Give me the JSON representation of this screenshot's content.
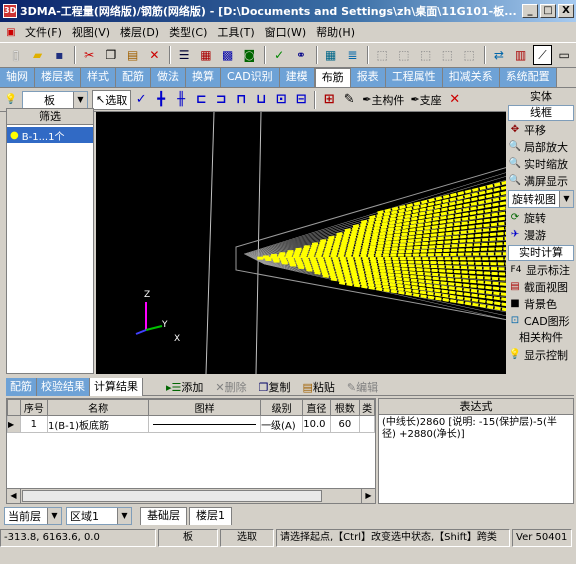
{
  "window": {
    "title": "3DMA-工程量(网络版)/钢筋(网络版) - [D:\\Documents and Settings\\zh\\桌面\\11G101-板...",
    "app_icon": "3D",
    "min": "_",
    "max": "□",
    "close": "X"
  },
  "menu": [
    "文件(F)",
    "视图(V)",
    "楼层(D)",
    "类型(C)",
    "工具(T)",
    "窗口(W)",
    "帮助(H)"
  ],
  "tabs": [
    "轴网",
    "楼层表",
    "样式",
    "配筋",
    "做法",
    "换算",
    "CAD识别",
    "建模",
    "布筋",
    "报表",
    "工程属性",
    "扣减关系",
    "系统配置"
  ],
  "active_tab": "布筋",
  "tool2": {
    "layer_combo": "板",
    "select": "选取",
    "main_member": "主构件",
    "support": "支座"
  },
  "left": {
    "header": "筛选",
    "item": "B-1...1个"
  },
  "right": {
    "header1": "实体",
    "box1": "线框",
    "items": [
      "平移",
      "局部放大",
      "实时缩放",
      "满屏显示"
    ],
    "rotate_combo": "旋转视图",
    "items2": [
      "旋转",
      "漫游"
    ],
    "calc": "实时计算",
    "f4": "F4",
    "items3": [
      "显示标注",
      "截面视图",
      "背景色",
      "CAD图形"
    ],
    "related": "相关构件",
    "display_ctrl": "显示控制"
  },
  "bottom_tabs": [
    "配筋",
    "校验结果",
    "计算结果"
  ],
  "bottom_active": "计算结果",
  "bottom_tools": {
    "add": "添加",
    "delete": "删除",
    "copy": "复制",
    "paste": "粘贴",
    "edit": "编辑"
  },
  "grid": {
    "headers": [
      "序号",
      "名称",
      "图样",
      "级别",
      "直径",
      "根数",
      "类"
    ],
    "rows": [
      {
        "no": "1",
        "name": "1(B-1)板底筋",
        "level": "一级(A)",
        "diameter": "10.0",
        "count": "60"
      }
    ]
  },
  "expr": {
    "header": "表达式",
    "text": "(中线长)2860 [说明: -15(保护层)-5(半径) +2880(净长)]"
  },
  "floor": {
    "current_label": "当前层",
    "region": "区域1",
    "tabs": [
      "基础层",
      "楼层1"
    ]
  },
  "status": {
    "coords": "-313.8, 6163.6, 0.0",
    "type": "板",
    "mode": "选取",
    "hint": "请选择起点,【Ctrl】改变选中状态,【Shift】跨类",
    "version": "Ver 50401"
  },
  "axes": {
    "z": "Z",
    "y": "Y",
    "x": "X"
  },
  "colors": {
    "rebar": "#ffff00",
    "wire": "#a0a0a0",
    "tab_bg": "#6ea2d6"
  }
}
